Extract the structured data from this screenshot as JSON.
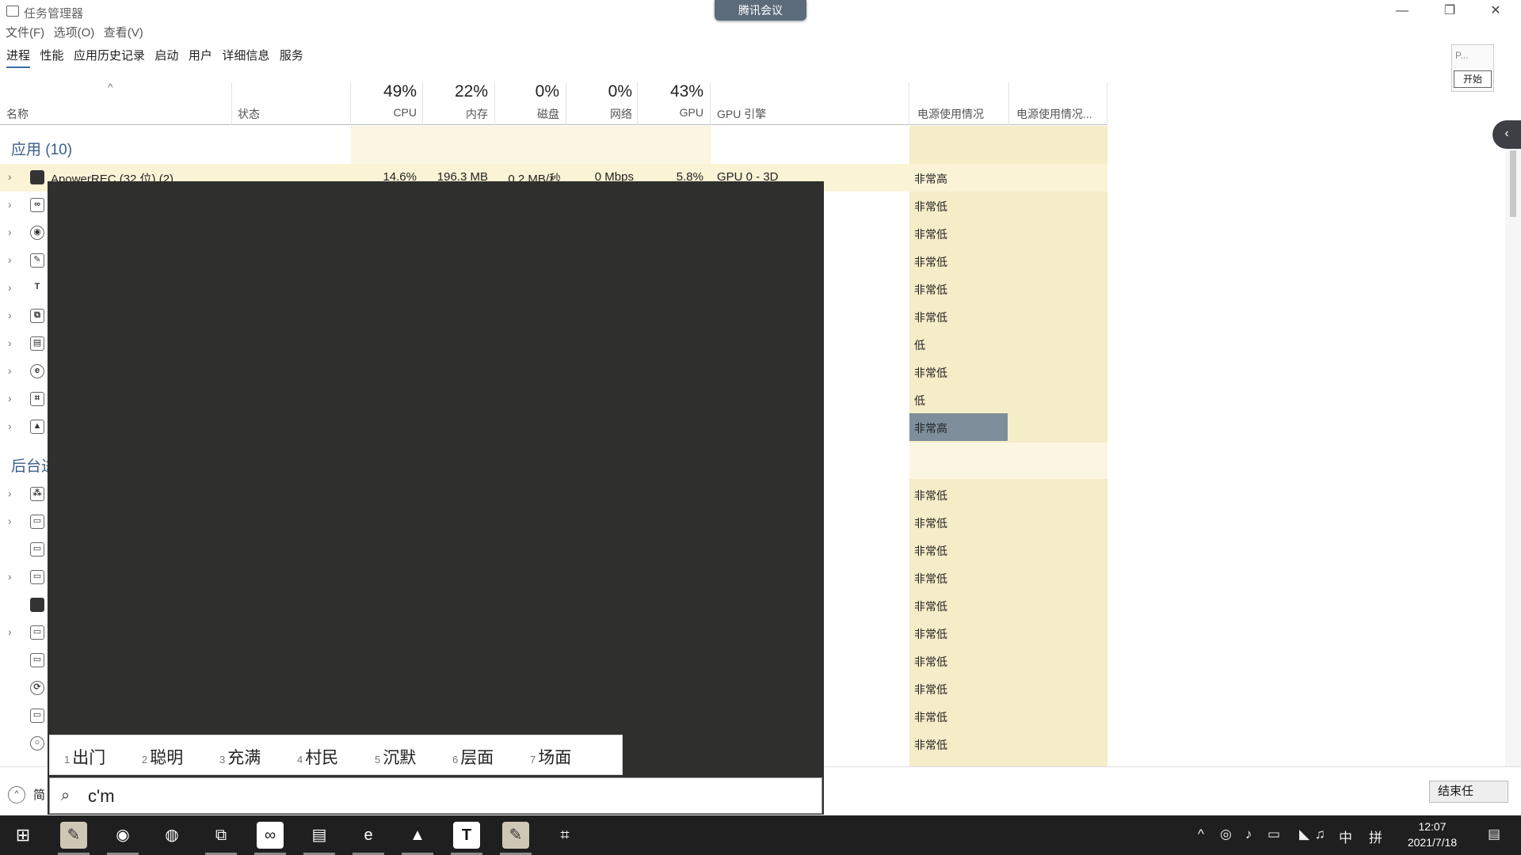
{
  "window": {
    "title": "任务管理器",
    "meeting_label": "腾讯会议",
    "btn_min": "—",
    "btn_max": "❐",
    "btn_close": "✕"
  },
  "menu": [
    "文件(F)",
    "选项(O)",
    "查看(V)"
  ],
  "tabs": [
    "进程",
    "性能",
    "应用历史记录",
    "启动",
    "用户",
    "详细信息",
    "服务"
  ],
  "side_panel": {
    "label": "P...",
    "start": "开始"
  },
  "columns": {
    "sort_arrow": "^",
    "name": "名称",
    "status": "状态",
    "cpu_pct": "49%",
    "cpu": "CPU",
    "mem_pct": "22%",
    "mem": "内存",
    "disk_pct": "0%",
    "disk": "磁盘",
    "net_pct": "0%",
    "net": "网络",
    "gpu_pct": "43%",
    "gpu": "GPU",
    "gpu_engine": "GPU 引擎",
    "power": "电源使用情况",
    "power_trend": "电源使用情况..."
  },
  "sections": {
    "apps": "应用 (10)",
    "background": "后台进"
  },
  "first_row": {
    "name": "ApowerREC (32 位) (2)",
    "cpu": "14.6%",
    "mem": "196.3 MB",
    "disk": "0.2 MB/秒",
    "net": "0 Mbps",
    "gpu": "5.8%",
    "engine": "GPU 0 - 3D",
    "power": "非常高"
  },
  "app_rows_power": [
    "非常低",
    "非常低",
    "非常低",
    "非常低",
    "非常低",
    "低",
    "非常低",
    "低",
    "非常高"
  ],
  "bg_rows_power": [
    "非常低",
    "非常低",
    "非常低",
    "非常低",
    "非常低",
    "非常低",
    "非常低",
    "非常低",
    "非常低",
    "非常低"
  ],
  "ime": {
    "candidates": [
      {
        "n": "1",
        "w": "出门"
      },
      {
        "n": "2",
        "w": "聪明"
      },
      {
        "n": "3",
        "w": "充满"
      },
      {
        "n": "4",
        "w": "村民"
      },
      {
        "n": "5",
        "w": "沉默"
      },
      {
        "n": "6",
        "w": "层面"
      },
      {
        "n": "7",
        "w": "场面"
      }
    ],
    "search_icon": "⌕",
    "input": "c'm"
  },
  "footer": {
    "less_details": "简",
    "end_task": "结束任"
  },
  "tray": {
    "lang": "中",
    "ime_mode": "拼",
    "time": "12:07",
    "date": "2021/7/18"
  },
  "taskbar_icons": [
    "windows-start-icon",
    "apowerrec-icon",
    "chrome-icon",
    "wechat-icon",
    "multiwindow-icon",
    "baidu-netdisk-icon",
    "folder-icon",
    "edge-icon",
    "photos-icon",
    "typora-icon",
    "screen-tool-icon",
    "chart-tool-icon"
  ]
}
